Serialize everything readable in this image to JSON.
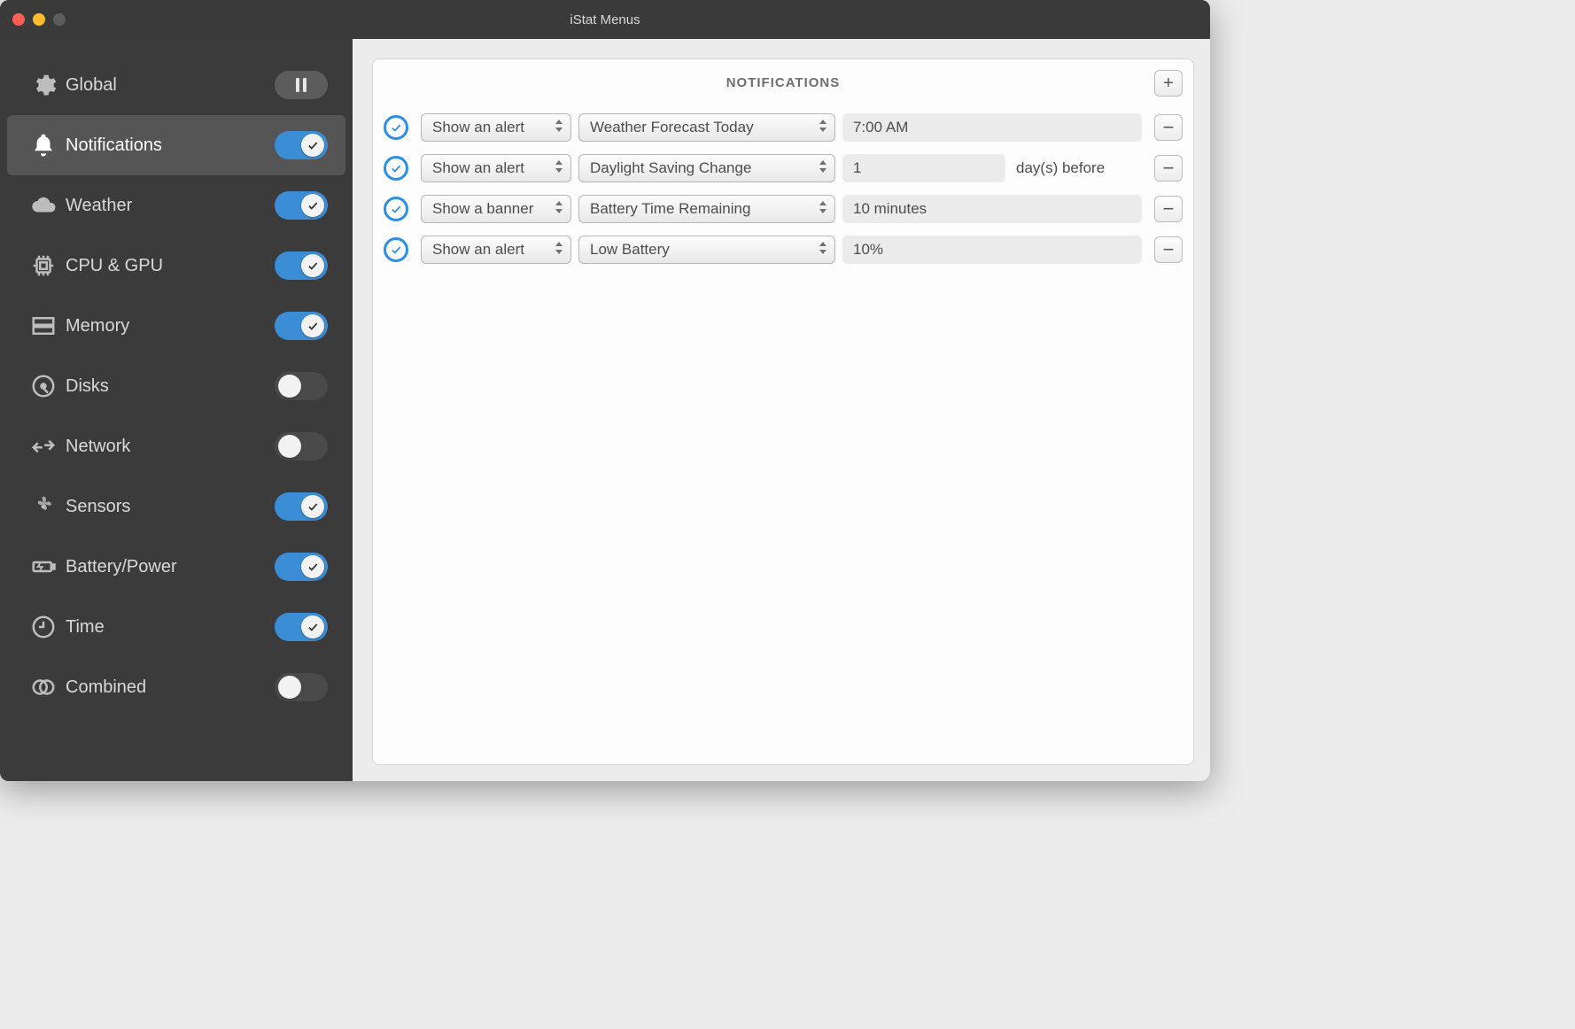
{
  "window": {
    "title": "iStat Menus"
  },
  "sidebar": {
    "items": [
      {
        "label": "Global"
      },
      {
        "label": "Notifications"
      },
      {
        "label": "Weather"
      },
      {
        "label": "CPU & GPU"
      },
      {
        "label": "Memory"
      },
      {
        "label": "Disks"
      },
      {
        "label": "Network"
      },
      {
        "label": "Sensors"
      },
      {
        "label": "Battery/Power"
      },
      {
        "label": "Time"
      },
      {
        "label": "Combined"
      }
    ]
  },
  "panel": {
    "title": "NOTIFICATIONS",
    "rows": [
      {
        "type": "Show an alert",
        "event": "Weather Forecast Today",
        "value": "7:00 AM",
        "suffix": ""
      },
      {
        "type": "Show an alert",
        "event": "Daylight Saving Change",
        "value": "1",
        "suffix": "day(s) before"
      },
      {
        "type": "Show a banner",
        "event": "Battery Time Remaining",
        "value": "10 minutes",
        "suffix": ""
      },
      {
        "type": "Show an alert",
        "event": "Low Battery",
        "value": "10%",
        "suffix": ""
      }
    ]
  }
}
